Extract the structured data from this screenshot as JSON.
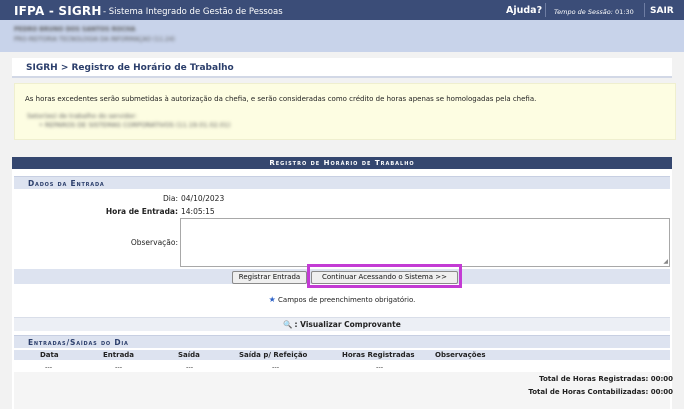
{
  "header": {
    "brand": "IFPA - SIGRH",
    "system_name": "- Sistema Integrado de Gestão de Pessoas",
    "help_label": "Ajuda?",
    "session_label": "Tempo de Sessão:",
    "session_time": "01:30",
    "logout_label": "SAIR"
  },
  "user": {
    "name": "PEDRO BRUNO DOS SANTOS ROCHA",
    "unit": "PRÓ-REITORIA TECNOLOGIA DA INFORMAÇÃO (11.24)"
  },
  "breadcrumb": "SIGRH > Registro de Horário de Trabalho",
  "notice": {
    "message": "As horas excedentes serão submetidas à autorização da chefia, e serão consideradas como crédito de horas apenas se homologadas pela chefia.",
    "blurred_title": "Setor(es) de trabalho do servidor:",
    "blurred_item": "REPAROS DE SISTEMAS CORPORATIVOS (11.19.01.02.01)"
  },
  "form": {
    "panel_title": "Registro de Horário de Trabalho",
    "section_title": "Dados da Entrada",
    "day_label": "Dia:",
    "day_value": "04/10/2023",
    "entry_time_label": "Hora de Entrada:",
    "entry_time_value": "14:05:15",
    "observation_label": "Observação:",
    "observation_value": "",
    "register_button": "Registrar Entrada",
    "continue_button": "Continuar Acessando o Sistema >>",
    "required_note": "Campos de preenchimento obrigatório.",
    "view_receipt": ": Visualizar Comprovante"
  },
  "entries": {
    "section_title": "Entradas/Saídas do Dia",
    "columns": [
      "Data",
      "Entrada",
      "Saída",
      "Saída p/ Refeição",
      "Horas Registradas",
      "Observações"
    ],
    "row": [
      "---",
      "---",
      "---",
      "---",
      "---"
    ],
    "total_registered": "Total de Horas Registradas: 00:00",
    "total_accounted": "Total de Horas Contabilizadas: 00:00"
  },
  "colors": {
    "header_bg": "#3b4d78",
    "highlight": "#c33bd4",
    "notice_bg": "#fdfde2"
  }
}
